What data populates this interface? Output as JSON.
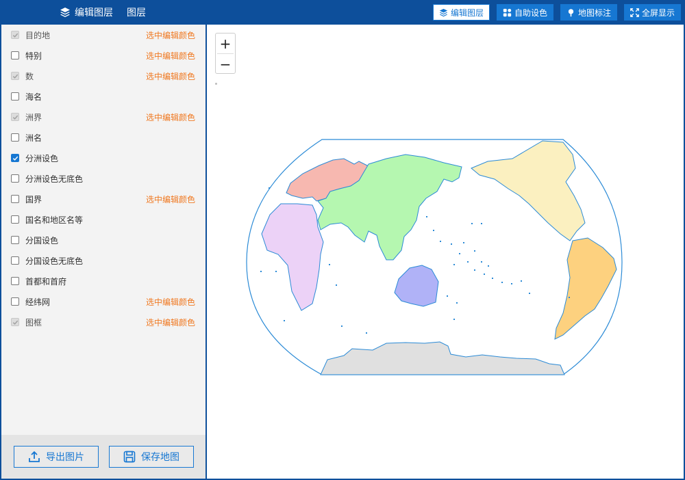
{
  "panel": {
    "title": "编辑图层",
    "subtitle": "图层"
  },
  "toolbar": {
    "edit_layers": "编辑图层",
    "auto_color": "自助设色",
    "map_marker": "地图标注",
    "fullscreen": "全屏显示"
  },
  "layers": [
    {
      "name": "目的地",
      "checked": true,
      "disabled": true,
      "edit": "选中编辑颜色"
    },
    {
      "name": "特别",
      "checked": false,
      "disabled": false,
      "edit": "选中编辑颜色"
    },
    {
      "name": "数",
      "checked": true,
      "disabled": true,
      "edit": "选中编辑颜色"
    },
    {
      "name": "海名",
      "checked": false,
      "disabled": false,
      "edit": ""
    },
    {
      "name": "洲界",
      "checked": true,
      "disabled": true,
      "edit": "选中编辑颜色"
    },
    {
      "name": "洲名",
      "checked": false,
      "disabled": false,
      "edit": ""
    },
    {
      "name": "分洲设色",
      "checked": true,
      "disabled": false,
      "edit": ""
    },
    {
      "name": "分洲设色无底色",
      "checked": false,
      "disabled": false,
      "edit": ""
    },
    {
      "name": "国界",
      "checked": false,
      "disabled": false,
      "edit": "选中编辑颜色"
    },
    {
      "name": "国名和地区名等",
      "checked": false,
      "disabled": false,
      "edit": ""
    },
    {
      "name": "分国设色",
      "checked": false,
      "disabled": false,
      "edit": ""
    },
    {
      "name": "分国设色无底色",
      "checked": false,
      "disabled": false,
      "edit": ""
    },
    {
      "name": "首都和首府",
      "checked": false,
      "disabled": false,
      "edit": ""
    },
    {
      "name": "经纬网",
      "checked": false,
      "disabled": false,
      "edit": "选中编辑颜色"
    },
    {
      "name": "图框",
      "checked": true,
      "disabled": true,
      "edit": "选中编辑颜色"
    }
  ],
  "bottom": {
    "export_label": "导出图片",
    "save_label": "保存地图"
  },
  "zoom": {
    "in": "+",
    "out": "−"
  },
  "colors": {
    "brand": "#0d4f9b",
    "accent": "#1677d2",
    "edit_link": "#f07820",
    "europe": "#f7b8b0",
    "asia": "#b5f7b0",
    "africa": "#ecd2f7",
    "north_america": "#fbf0c0",
    "south_america": "#fdd17f",
    "oceania": "#b0b2f7",
    "antarctica": "#e0e0e0",
    "coast": "#2a8ad6"
  }
}
